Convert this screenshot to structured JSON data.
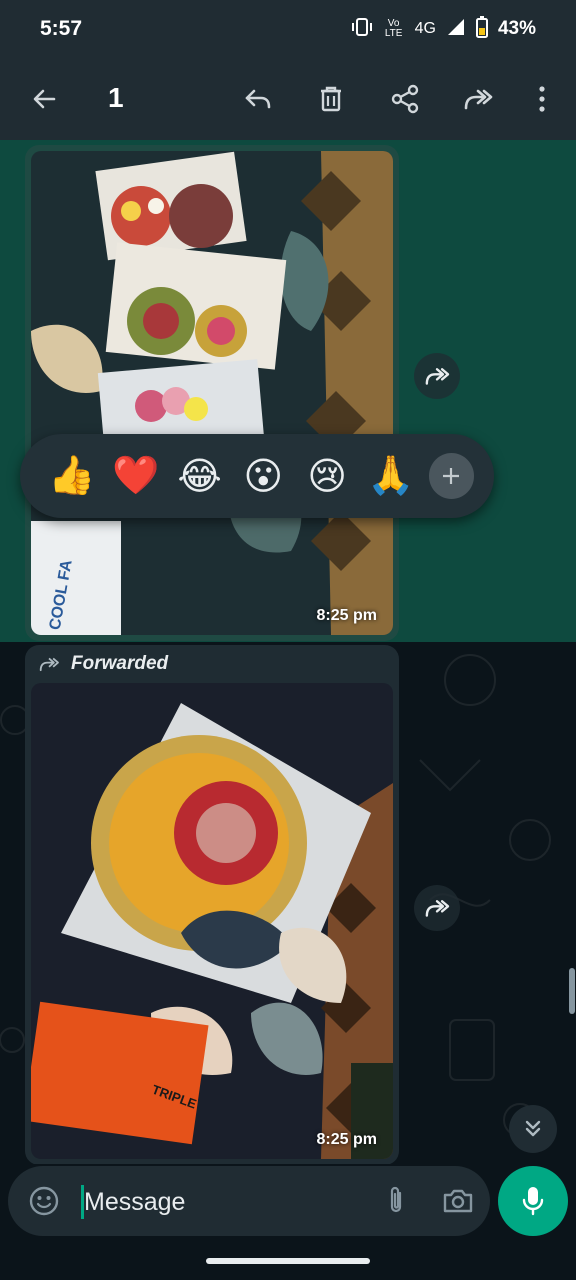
{
  "status_bar": {
    "time": "5:57",
    "network": "4G",
    "volte": "Vo LTE",
    "battery": "43%"
  },
  "app_bar": {
    "selected_count": "1",
    "icons": [
      "back-arrow-icon",
      "reply-icon",
      "delete-icon",
      "share-icon",
      "forward-icon",
      "more-vert-icon"
    ]
  },
  "messages": [
    {
      "type": "image",
      "time": "8:25 pm",
      "selected": true,
      "forwarded": false
    },
    {
      "type": "image",
      "time": "8:25 pm",
      "selected": false,
      "forwarded": true,
      "forwarded_label": "Forwarded"
    }
  ],
  "reactions": {
    "emojis": [
      "👍",
      "❤️",
      "😂",
      "😮",
      "😢",
      "🙏"
    ],
    "more_icon": "plus-icon"
  },
  "input": {
    "placeholder": "Message",
    "value": ""
  },
  "colors": {
    "header_bg": "#202c33",
    "chat_bg": "#0b141a",
    "selection_bg": "#0e4a3f",
    "accent": "#00a884"
  }
}
